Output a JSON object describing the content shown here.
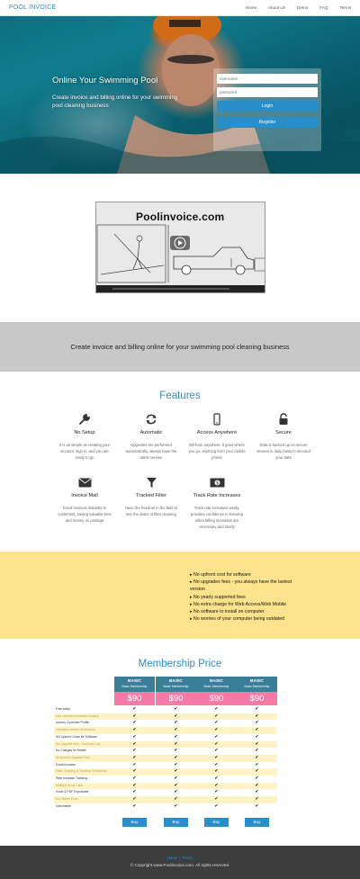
{
  "nav": {
    "brand": "POOL INVOICE",
    "items": [
      {
        "label": "Home"
      },
      {
        "label": "About Us"
      },
      {
        "label": "Demo"
      },
      {
        "label": "FAQ"
      },
      {
        "label": "Terms"
      }
    ]
  },
  "hero": {
    "title": "Online Your Swimming Pool",
    "subtitle": "Create invoice and billing online for your swimming pool cleaning business",
    "login": {
      "username_placeholder": "username",
      "password_placeholder": "password",
      "login_label": "Login",
      "register_label": "Register"
    }
  },
  "video": {
    "title": "Poolinvoice.com"
  },
  "banner": {
    "text": "Create invoice and billing online for your swimming pool cleaning business"
  },
  "features": {
    "title": "Features",
    "items": [
      {
        "icon": "wrench-icon",
        "title": "No Setup",
        "desc": "It is as simple as creating your account, sign in, and you are ready to go"
      },
      {
        "icon": "refresh-icon",
        "title": "Automatic",
        "desc": "Upgrades are performed automatically, always have the latest version"
      },
      {
        "icon": "mobile-icon",
        "title": "Access Anywhere",
        "desc": "Bill from anywhere, it goes where you go, anything form your mobile phone"
      },
      {
        "icon": "unlock-icon",
        "title": "Secure",
        "desc": "Data is backed up on secure servers in daily basis to secured your data"
      },
      {
        "icon": "envelope-icon",
        "title": "Invoice Mail",
        "desc": "Email invoices instantly to customers, saving valuable time and money on postage"
      },
      {
        "icon": "filter-icon",
        "title": "Tracked Filter",
        "desc": "Have the freedom in the field to see the dates of filter cleaning"
      },
      {
        "icon": "money-icon",
        "title": "Track Rate Increases",
        "desc": "Track rate increases easily, provides confidence in knowing when billing increases are necessary and timely"
      }
    ]
  },
  "benefits": [
    "No upfront cost for software",
    "No upgrades fees - you always have the lastest version",
    "No yearly supported fees",
    "No extra charge for Web Access/Web Mobile",
    "No software to install on computer",
    "No worries of your computer being outdated"
  ],
  "pricing": {
    "title": "Membership Price",
    "plans": [
      {
        "name": "BASIC",
        "sub": "Basic Membership",
        "price": "$90",
        "buy": "Buy"
      },
      {
        "name": "BASIC",
        "sub": "Basic Membership",
        "price": "$90",
        "buy": "Buy"
      },
      {
        "name": "BASIC",
        "sub": "Basic Membership",
        "price": "$90",
        "buy": "Buy"
      },
      {
        "name": "BASIC",
        "sub": "Basic Membership",
        "price": "$90",
        "buy": "Buy"
      }
    ],
    "check": "✔",
    "features": [
      "Free setup",
      "Add unlimited customer location",
      "Access Customer Profile",
      "Unlimited number of invoices",
      "NO Upfront Costs for Software",
      "No Upgrade fees - Tracking Cost",
      "No Charges for Mobile",
      "No Annual Upgrade Fees",
      "Email Invoices",
      "Filter Cleaning & Tracking Scheduling",
      "Rate Increase Tracking",
      "Multiple Group Lists",
      "Excel & PDF Exportable",
      "No Hidden Fees",
      "Cancelable"
    ]
  },
  "footer": {
    "links": [
      "Home",
      "Terms"
    ],
    "copyright": "© Copyright www.Poolinvoice.com. All rights reserved."
  },
  "colors": {
    "accent": "#2a8fc9",
    "yellow": "#fde38e",
    "price_header": "#3b7e99",
    "price_pink": "#f37ba5",
    "footer": "#3d3d3d"
  }
}
